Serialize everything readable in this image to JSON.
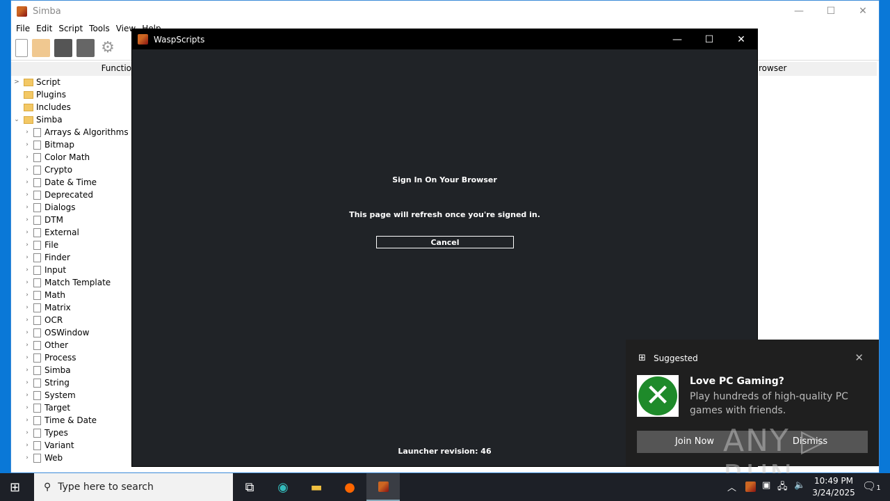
{
  "simba": {
    "title": "Simba",
    "menu": [
      "File",
      "Edit",
      "Script",
      "Tools",
      "View",
      "Help"
    ],
    "functions_header": "Functio",
    "browser_header": "rowser",
    "tree": [
      {
        "label": "Script",
        "type": "folder",
        "arrow": ">"
      },
      {
        "label": "Plugins",
        "type": "folder",
        "arrow": ""
      },
      {
        "label": "Includes",
        "type": "folder",
        "arrow": ""
      },
      {
        "label": "Simba",
        "type": "folder",
        "arrow": "v"
      },
      {
        "label": "Arrays & Algorithms",
        "type": "doc"
      },
      {
        "label": "Bitmap",
        "type": "doc"
      },
      {
        "label": "Color Math",
        "type": "doc"
      },
      {
        "label": "Crypto",
        "type": "doc"
      },
      {
        "label": "Date & Time",
        "type": "doc"
      },
      {
        "label": "Deprecated",
        "type": "doc"
      },
      {
        "label": "Dialogs",
        "type": "doc"
      },
      {
        "label": "DTM",
        "type": "doc"
      },
      {
        "label": "External",
        "type": "doc"
      },
      {
        "label": "File",
        "type": "doc"
      },
      {
        "label": "Finder",
        "type": "doc"
      },
      {
        "label": "Input",
        "type": "doc"
      },
      {
        "label": "Match Template",
        "type": "doc"
      },
      {
        "label": "Math",
        "type": "doc"
      },
      {
        "label": "Matrix",
        "type": "doc"
      },
      {
        "label": "OCR",
        "type": "doc"
      },
      {
        "label": "OSWindow",
        "type": "doc"
      },
      {
        "label": "Other",
        "type": "doc"
      },
      {
        "label": "Process",
        "type": "doc"
      },
      {
        "label": "Simba",
        "type": "doc"
      },
      {
        "label": "String",
        "type": "doc"
      },
      {
        "label": "System",
        "type": "doc"
      },
      {
        "label": "Target",
        "type": "doc"
      },
      {
        "label": "Time & Date",
        "type": "doc"
      },
      {
        "label": "Types",
        "type": "doc"
      },
      {
        "label": "Variant",
        "type": "doc"
      },
      {
        "label": "Web",
        "type": "doc"
      }
    ]
  },
  "wasp": {
    "title": "WaspScripts",
    "heading": "Sign In On Your Browser",
    "message": "This page will refresh once you're signed in.",
    "cancel": "Cancel",
    "revision": "Launcher revision: 46"
  },
  "toast": {
    "category": "Suggested",
    "title": "Love PC Gaming?",
    "body": "Play hundreds of high-quality PC games with friends.",
    "join": "Join Now",
    "dismiss": "Dismiss",
    "watermark": "ANY RUN"
  },
  "taskbar": {
    "search_placeholder": "Type here to search",
    "time": "10:49 PM",
    "date": "3/24/2025",
    "notifications": "1"
  }
}
